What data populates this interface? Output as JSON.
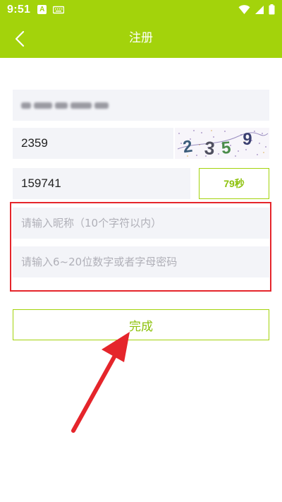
{
  "status_bar": {
    "time": "9:51",
    "left_icons": [
      "a-notification-icon",
      "keyboard-icon"
    ],
    "right_icons": [
      "wifi-icon",
      "signal-icon",
      "battery-icon"
    ]
  },
  "app_bar": {
    "title": "注册",
    "back_icon": "chevron-left-icon"
  },
  "form": {
    "phone": {
      "value": "",
      "blurred": true
    },
    "captcha_input": {
      "value": "2359"
    },
    "captcha_image": {
      "text": "2359"
    },
    "sms_code": {
      "value": "159741"
    },
    "resend_button": {
      "label": "79秒"
    },
    "nickname": {
      "value": "",
      "placeholder": "请输入昵称（10个字符以内）"
    },
    "password": {
      "value": "",
      "placeholder": "请输入6~20位数字或者字母密码"
    },
    "submit_button": {
      "label": "完成"
    }
  },
  "colors": {
    "brand": "#a3d30b",
    "brand_text": "#8cc10a",
    "field_bg": "#f3f4f8",
    "annotation": "#e5252b"
  }
}
